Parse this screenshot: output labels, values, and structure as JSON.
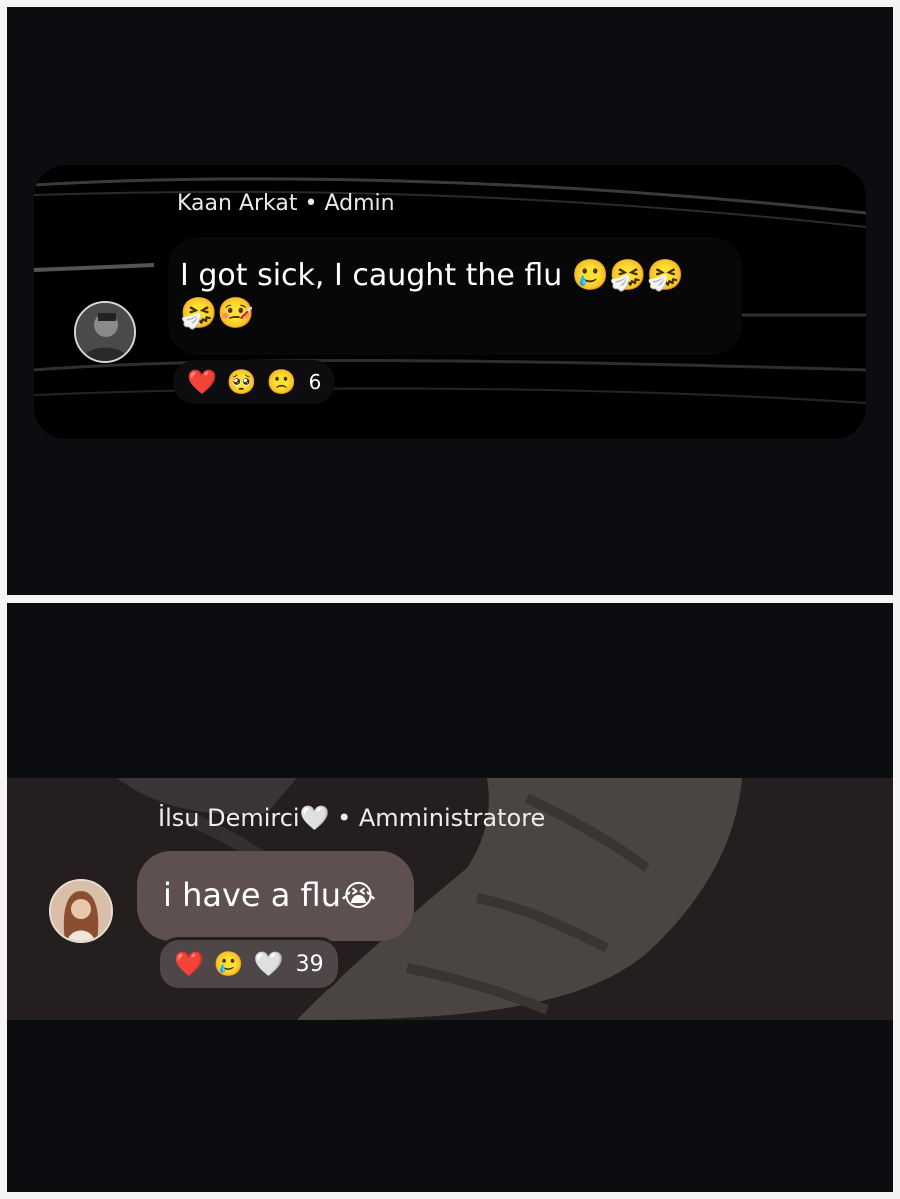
{
  "top_message": {
    "sender": "Kaan Arkat • Admin",
    "text": "I got sick, I caught the flu",
    "emojis": [
      "🥲",
      "🤧",
      "🤧",
      "🤧",
      "🤒"
    ],
    "reactions": [
      "❤️",
      "🥺",
      "🙁"
    ],
    "reaction_count": "6",
    "avatar": "user-avatar-photo"
  },
  "bottom_message": {
    "sender": "İlsu Demirci🤍 • Amministratore",
    "text": "i have a flu",
    "emojis": [
      "😭"
    ],
    "reactions": [
      "❤️",
      "🥲",
      "🤍"
    ],
    "reaction_count": "39",
    "avatar": "user-avatar-photo"
  },
  "colors": {
    "panel_background": "#0c0d11",
    "top_card_background": "#000000",
    "bottom_band_background": "#241e1f",
    "bottom_bubble": "#5e5051",
    "text": "#ffffff"
  }
}
